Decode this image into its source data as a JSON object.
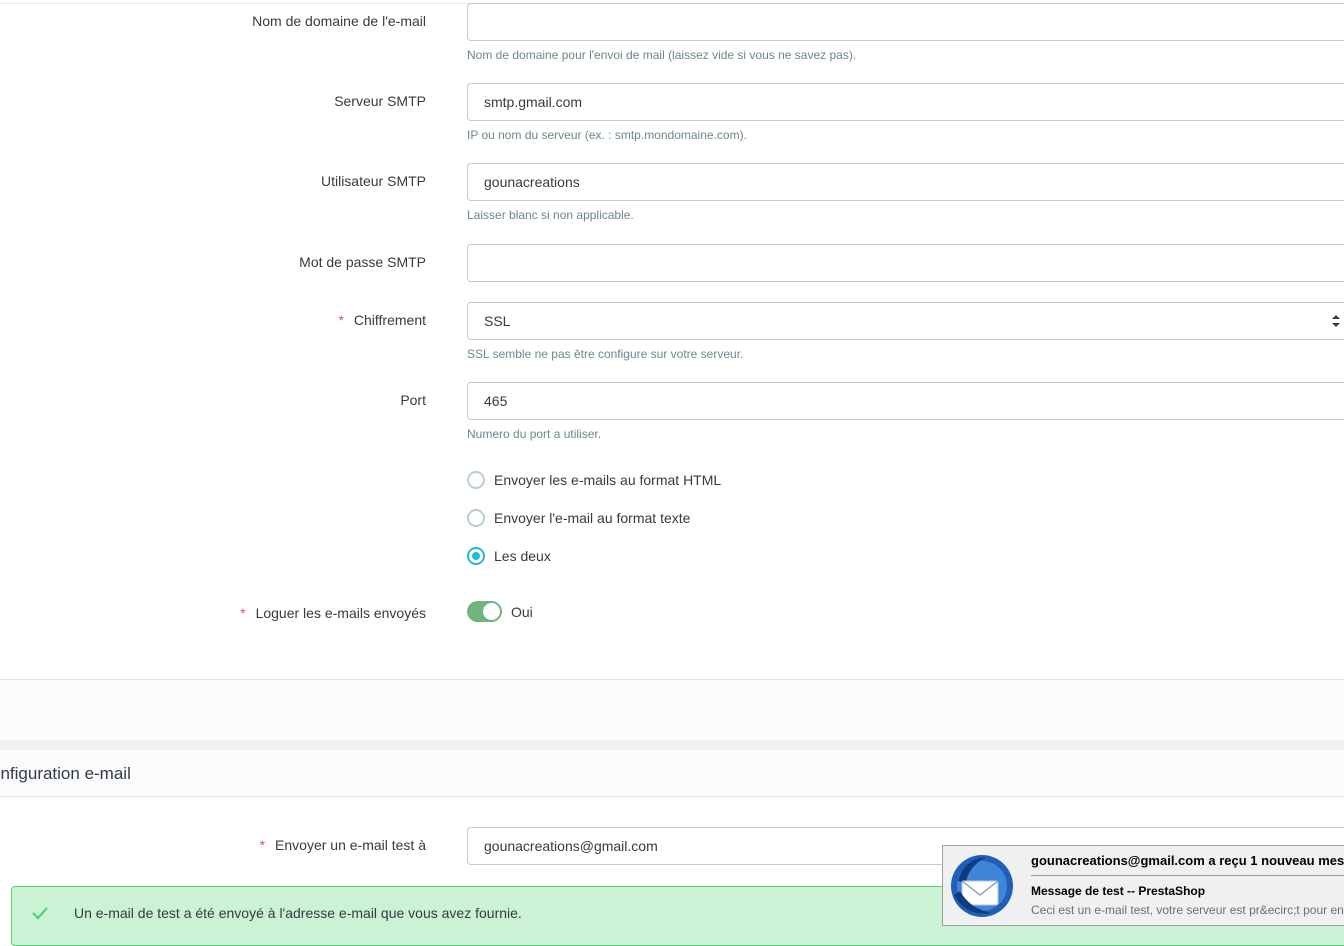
{
  "form": {
    "email_domain": {
      "label": "Nom de domaine de l'e-mail",
      "value": "",
      "help": "Nom de domaine pour l'envoi de mail (laissez vide si vous ne savez pas)."
    },
    "smtp_server": {
      "label": "Serveur SMTP",
      "value": "smtp.gmail.com",
      "help": "IP ou nom du serveur (ex. : smtp.mondomaine.com)."
    },
    "smtp_user": {
      "label": "Utilisateur SMTP",
      "value": "gounacreations",
      "help": "Laisser blanc si non applicable."
    },
    "smtp_password": {
      "label": "Mot de passe SMTP",
      "value": ""
    },
    "encryption": {
      "required_mark": "*",
      "label": "Chiffrement",
      "value": "SSL",
      "help": "SSL semble ne pas être configure sur votre serveur."
    },
    "port": {
      "label": "Port",
      "value": "465",
      "help": "Numero du port a utiliser."
    },
    "format_options": [
      {
        "label": "Envoyer les e-mails au format HTML",
        "checked": false
      },
      {
        "label": "Envoyer l'e-mail au format texte",
        "checked": false
      },
      {
        "label": "Les deux",
        "checked": true
      }
    ],
    "log_emails": {
      "required_mark": "*",
      "label": "Loguer les e-mails envoyés",
      "state_label": "Oui",
      "enabled": true
    }
  },
  "test_section": {
    "title": "onfiguration e-mail",
    "send_test": {
      "required_mark": "*",
      "label": "Envoyer un e-mail test à",
      "value": "gounacreations@gmail.com"
    },
    "success_message": "Un e-mail de test a été envoyé à l'adresse e-mail que vous avez fournie."
  },
  "notification": {
    "title": "gounacreations@gmail.com a reçu 1 nouveau mess",
    "subject": "Message de test -- PrestaShop",
    "preview": "Ceci est un e-mail test, votre serveur est pr&ecirc;t pour env",
    "icon": "thunderbird-icon"
  },
  "colors": {
    "accent": "#25b9d7",
    "switch_on": "#70b580",
    "success_bg": "#cbf2d4",
    "success_border": "#53d572",
    "required": "#c05c67"
  }
}
